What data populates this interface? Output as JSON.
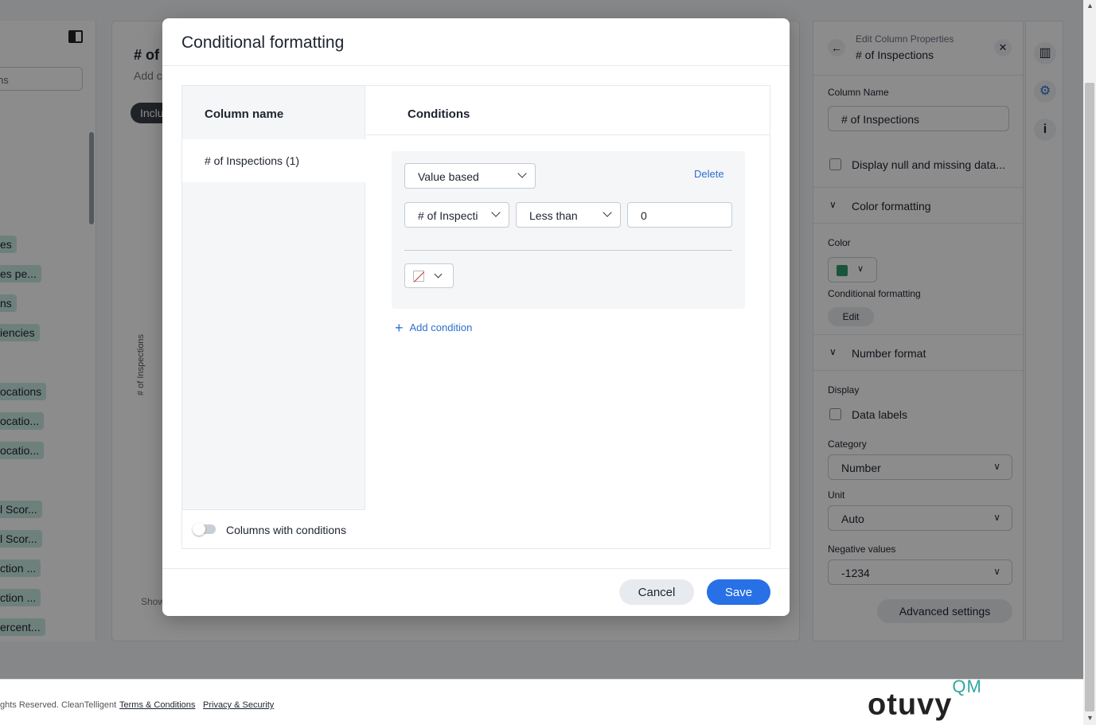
{
  "left_panel": {
    "search_value": "ns",
    "chips": [
      "es",
      "es pe...",
      "ns",
      "iencies",
      "ocations",
      "ocatio...",
      "ocatio...",
      "l Scor...",
      "l Scor...",
      "ction ...",
      "ction ...",
      "ercent..."
    ]
  },
  "center_panel": {
    "title": "# of",
    "subtitle": "Add c",
    "pill": "Inclu",
    "axis_label": "# of Inspections",
    "show_text": "Show"
  },
  "right_panel": {
    "kicker": "Edit Column Properties",
    "title": "# of Inspections",
    "column_name_label": "Column Name",
    "column_name_value": "# of Inspections",
    "display_null_label": "Display null and missing data...",
    "color_formatting_section": "Color formatting",
    "color_label": "Color",
    "color_value": "#2f9b6e",
    "conditional_formatting_label": "Conditional formatting",
    "edit_button": "Edit",
    "number_format_section": "Number format",
    "display_label": "Display",
    "data_labels_label": "Data labels",
    "category_label": "Category",
    "category_value": "Number",
    "unit_label": "Unit",
    "unit_value": "Auto",
    "negative_values_label": "Negative values",
    "negative_values_value": "-1234",
    "advanced_settings_button": "Advanced settings"
  },
  "modal": {
    "title": "Conditional formatting",
    "column_name_header": "Column name",
    "conditions_header": "Conditions",
    "column_item": "# of Inspections (1)",
    "columns_with_conditions_label": "Columns with conditions",
    "condition": {
      "type": "Value based",
      "delete_label": "Delete",
      "field": "# of Inspecti",
      "operator": "Less than",
      "value": "0"
    },
    "add_condition_label": "Add condition",
    "cancel_label": "Cancel",
    "save_label": "Save"
  },
  "footer": {
    "copyright": "ghts Reserved. CleanTelligent",
    "terms_link": "Terms & Conditions",
    "privacy_link": "Privacy & Security",
    "logo_text": "otuvy",
    "logo_suffix": "QM"
  }
}
